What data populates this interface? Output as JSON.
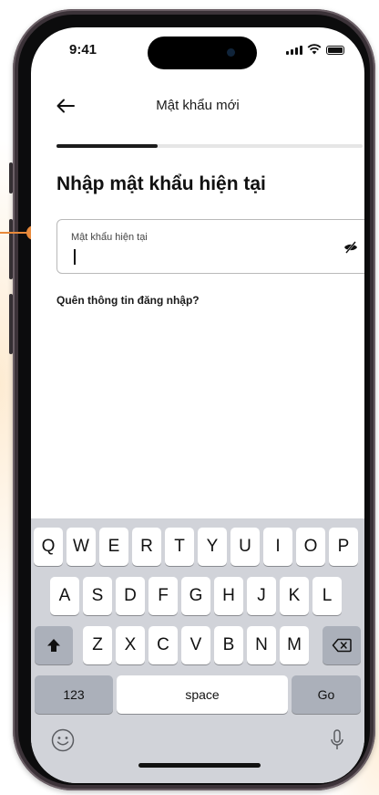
{
  "status_bar": {
    "time": "9:41"
  },
  "header": {
    "title": "Mật khẩu mới",
    "back_icon": "arrow-left-icon"
  },
  "progress": {
    "value": 0.33
  },
  "page": {
    "heading": "Nhập mật khẩu hiện tại"
  },
  "password_field": {
    "label": "Mật khẩu hiện tại",
    "value": "",
    "toggle_icon": "eye-off-icon"
  },
  "forgot_link": {
    "label": "Quên thông tin đăng nhập?"
  },
  "keyboard": {
    "row1": [
      "Q",
      "W",
      "E",
      "R",
      "T",
      "Y",
      "U",
      "I",
      "O",
      "P"
    ],
    "row2": [
      "A",
      "S",
      "D",
      "F",
      "G",
      "H",
      "J",
      "K",
      "L"
    ],
    "row3": [
      "Z",
      "X",
      "C",
      "V",
      "B",
      "N",
      "M"
    ],
    "numbers_label": "123",
    "space_label": "space",
    "go_label": "Go",
    "shift_icon": "shift-icon",
    "delete_icon": "backspace-icon",
    "emoji_icon": "emoji-icon",
    "mic_icon": "microphone-icon"
  },
  "colors": {
    "accent": "#e8893a",
    "text": "#111111",
    "keyboard_bg": "#d1d3d9"
  }
}
